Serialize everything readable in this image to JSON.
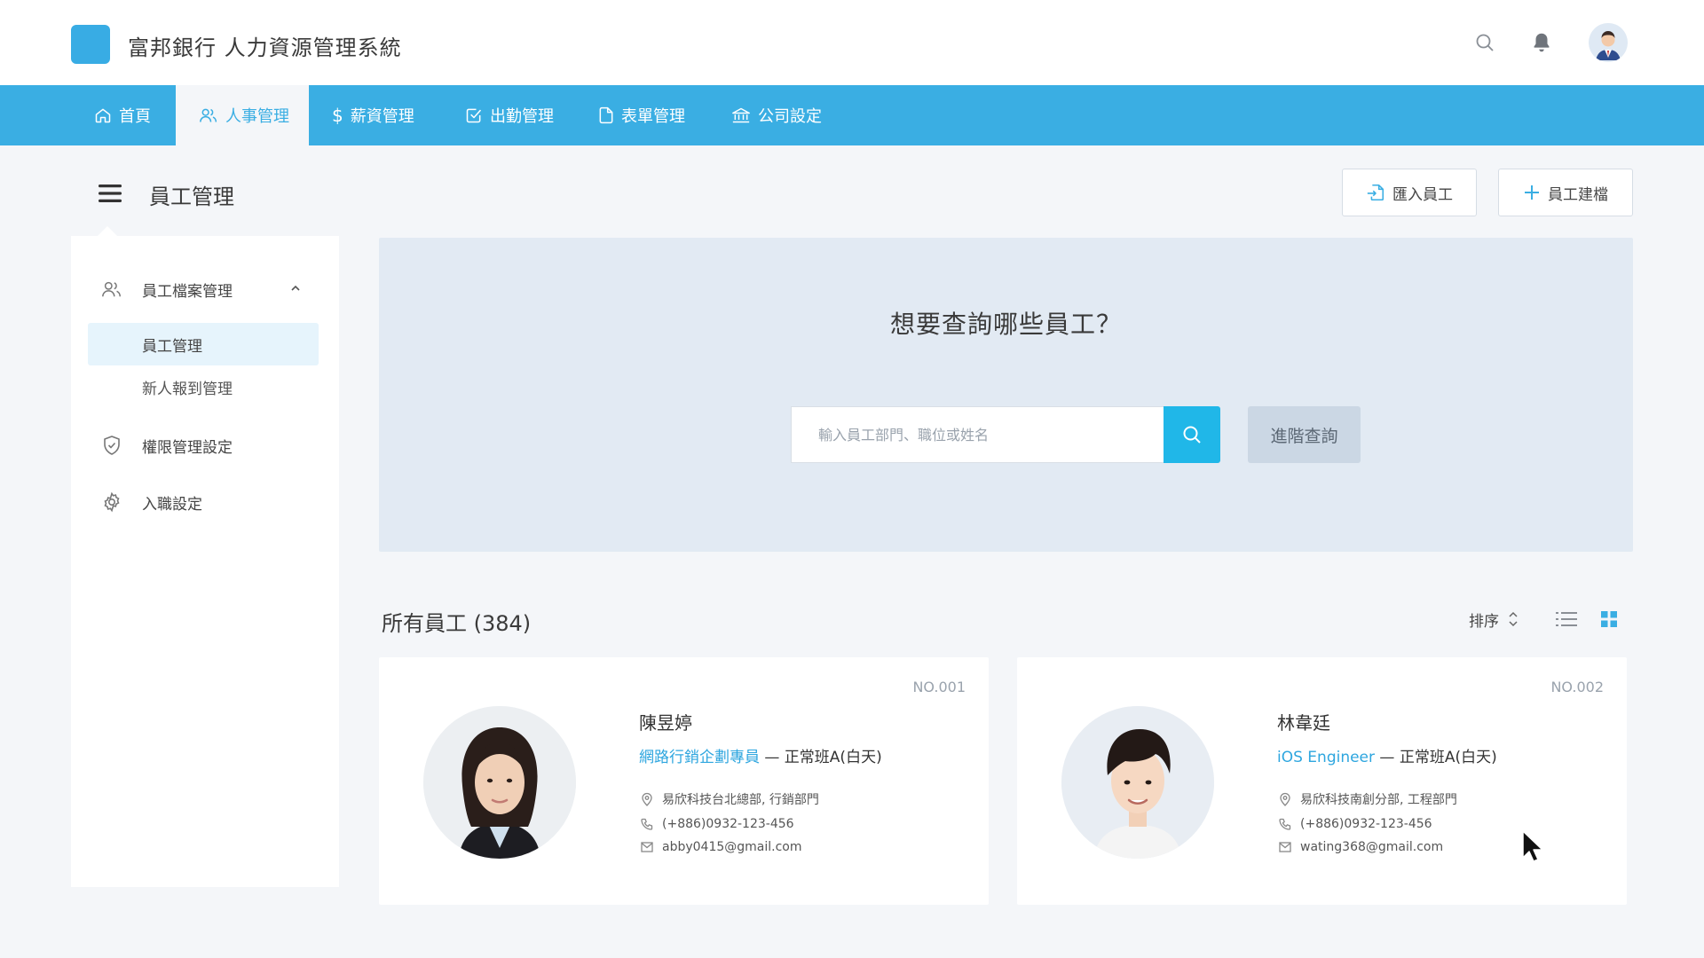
{
  "app": {
    "title": "富邦銀行 人力資源管理系統",
    "accent_color": "#3aaee3",
    "logo_color": "#38ace4"
  },
  "header": {
    "icons": [
      "search-icon",
      "bell-icon",
      "user-avatar"
    ]
  },
  "nav": {
    "tabs": [
      {
        "label": "首頁",
        "icon": "home-icon",
        "active": false
      },
      {
        "label": "人事管理",
        "icon": "users-icon",
        "active": true
      },
      {
        "label": "薪資管理",
        "icon": "dollar-icon",
        "active": false
      },
      {
        "label": "出勤管理",
        "icon": "check-square-icon",
        "active": false
      },
      {
        "label": "表單管理",
        "icon": "document-icon",
        "active": false
      },
      {
        "label": "公司設定",
        "icon": "bank-icon",
        "active": false
      }
    ]
  },
  "page": {
    "title": "員工管理",
    "import_button": "匯入員工",
    "create_button": "員工建檔"
  },
  "sidebar": {
    "groups": [
      {
        "label": "員工檔案管理",
        "icon": "users-icon",
        "expanded": true,
        "children": [
          {
            "label": "員工管理",
            "active": true
          },
          {
            "label": "新人報到管理",
            "active": false
          }
        ]
      },
      {
        "label": "權限管理設定",
        "icon": "shield-check-icon"
      },
      {
        "label": "入職設定",
        "icon": "gear-icon"
      }
    ]
  },
  "search": {
    "heading": "想要查詢哪些員工？",
    "placeholder": "輸入員工部門、職位或姓名",
    "value": "",
    "advanced_button": "進階查詢"
  },
  "list": {
    "title": "所有員工 (384)",
    "sort_label": "排序",
    "view_modes": [
      "list-view-icon",
      "grid-view-icon"
    ],
    "active_view": "grid"
  },
  "employees": [
    {
      "no": "NO.001",
      "name": "陳昱婷",
      "role": "網路行銷企劃專員",
      "shift": " — 正常班A(白天)",
      "location": "易欣科技台北總部, 行銷部門",
      "phone": "(+886)0932-123-456",
      "email": "abby0415@gmail.com"
    },
    {
      "no": "NO.002",
      "name": "林韋廷",
      "role": "iOS Engineer",
      "shift": " — 正常班A(白天)",
      "location": "易欣科技南創分部, 工程部門",
      "phone": "(+886)0932-123-456",
      "email": "wating368@gmail.com"
    }
  ]
}
